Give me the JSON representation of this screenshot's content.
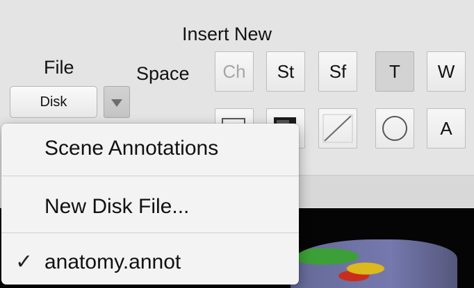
{
  "labels": {
    "insert_new": "Insert New",
    "file": "File",
    "space": "Space"
  },
  "file_picker": {
    "value": "Disk"
  },
  "toolbar_row1": [
    "Ch",
    "St",
    "Sf",
    "T",
    "W"
  ],
  "toolbar_row2_text": "A",
  "menu": {
    "items": [
      "Scene Annotations",
      "New Disk File...",
      "anatomy.annot"
    ],
    "checked": "anatomy.annot"
  },
  "icons": {
    "chevron": "chevron-down-icon",
    "check": "checkmark-icon",
    "rectangle": "rectangle-icon",
    "filled_rectangle": "filled-rectangle-icon",
    "line": "line-icon",
    "oval": "oval-icon"
  },
  "colors": {
    "menu_bg": "#f3f3f3",
    "panel_bg": "#e4e4e4",
    "viewer_bg": "#050505"
  }
}
